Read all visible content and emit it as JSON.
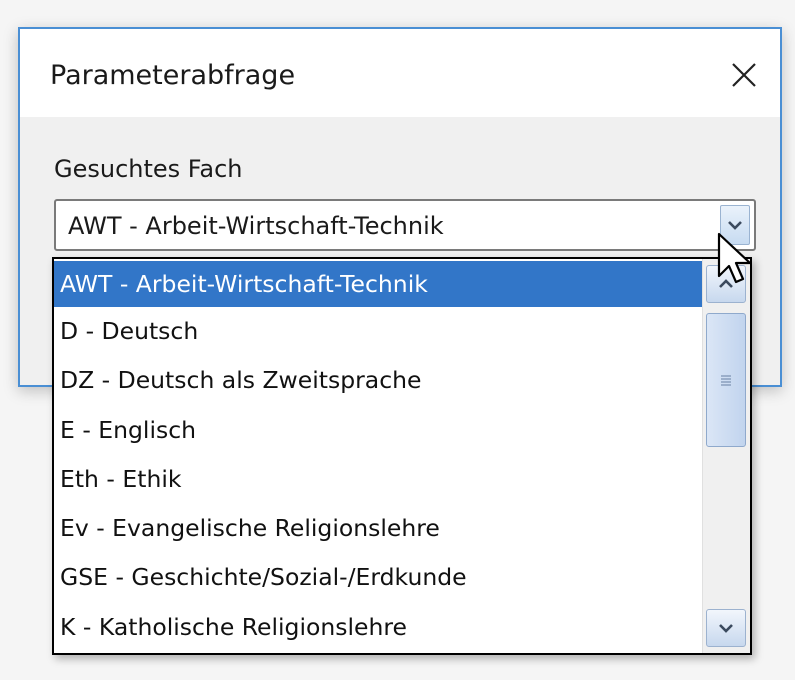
{
  "dialog": {
    "title": "Parameterabfrage",
    "close_icon": "close-icon"
  },
  "field": {
    "label": "Gesuchtes Fach",
    "value": "AWT - Arbeit-Wirtschaft-Technik",
    "arrow_icon": "chevron-down-icon"
  },
  "dropdown": {
    "selected_index": 0,
    "items": [
      "AWT - Arbeit-Wirtschaft-Technik",
      "D - Deutsch",
      "DZ - Deutsch als Zweitsprache",
      "E - Englisch",
      "Eth - Ethik",
      "Ev - Evangelische Religionslehre",
      "GSE - Geschichte/Sozial-/Erdkunde",
      "K - Katholische Religionslehre"
    ],
    "scroll_up_icon": "chevron-up-icon",
    "scroll_down_icon": "chevron-down-icon",
    "thumb_grip_icon": "grip-icon"
  },
  "colors": {
    "selection": "#3276c8",
    "dialog_border": "#4a8fd4"
  }
}
